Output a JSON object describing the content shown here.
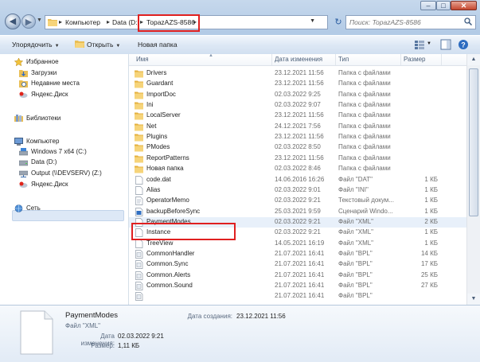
{
  "titlebar": {
    "min": "–",
    "max": "□",
    "close": "✕"
  },
  "address": {
    "crumbs": [
      "Компьютер",
      "Data (D:)",
      "TopazAZS-8586"
    ],
    "search_placeholder": "Поиск: TopazAZS-8586"
  },
  "toolbar": {
    "organize": "Упорядочить",
    "open": "Открыть",
    "new_folder": "Новая папка"
  },
  "nav": {
    "favorites": {
      "label": "Избранное",
      "items": [
        "Загрузки",
        "Недавние места",
        "Яндекс.Диск"
      ]
    },
    "libraries": "Библиотеки",
    "computer": {
      "label": "Компьютер",
      "items": [
        "Windows 7 x64 (C:)",
        "Data (D:)",
        "Output (\\\\DEVSERV) (Z:)",
        "Яндекс.Диск"
      ]
    },
    "network": "Сеть"
  },
  "columns": {
    "name": "Имя",
    "date": "Дата изменения",
    "type": "Тип",
    "size": "Размер"
  },
  "files": [
    {
      "name": "Drivers",
      "date": "23.12.2021 11:56",
      "type": "Папка с файлами",
      "size": "",
      "icon": "folder-icon"
    },
    {
      "name": "Guardant",
      "date": "23.12.2021 11:56",
      "type": "Папка с файлами",
      "size": "",
      "icon": "folder-icon"
    },
    {
      "name": "ImportDoc",
      "date": "02.03.2022 9:25",
      "type": "Папка с файлами",
      "size": "",
      "icon": "folder-icon"
    },
    {
      "name": "Ini",
      "date": "02.03.2022 9:07",
      "type": "Папка с файлами",
      "size": "",
      "icon": "folder-icon"
    },
    {
      "name": "LocalServer",
      "date": "23.12.2021 11:56",
      "type": "Папка с файлами",
      "size": "",
      "icon": "folder-icon"
    },
    {
      "name": "Net",
      "date": "24.12.2021 7:56",
      "type": "Папка с файлами",
      "size": "",
      "icon": "folder-icon"
    },
    {
      "name": "Plugins",
      "date": "23.12.2021 11:56",
      "type": "Папка с файлами",
      "size": "",
      "icon": "folder-icon"
    },
    {
      "name": "PModes",
      "date": "02.03.2022 8:50",
      "type": "Папка с файлами",
      "size": "",
      "icon": "folder-icon"
    },
    {
      "name": "ReportPatterns",
      "date": "23.12.2021 11:56",
      "type": "Папка с файлами",
      "size": "",
      "icon": "folder-icon"
    },
    {
      "name": "Новая папка",
      "date": "02.03.2022 8:46",
      "type": "Папка с файлами",
      "size": "",
      "icon": "folder-icon"
    },
    {
      "name": "code.dat",
      "date": "14.06.2016 16:26",
      "type": "Файл \"DAT\"",
      "size": "1 КБ",
      "icon": "file-icon"
    },
    {
      "name": "Alias",
      "date": "02.03.2022 9:01",
      "type": "Файл \"INI\"",
      "size": "1 КБ",
      "icon": "file-icon"
    },
    {
      "name": "OperatorMemo",
      "date": "02.03.2022 9:21",
      "type": "Текстовый докум...",
      "size": "1 КБ",
      "icon": "text-file-icon"
    },
    {
      "name": "backupBeforeSync",
      "date": "25.03.2021 9:59",
      "type": "Сценарий Windo...",
      "size": "1 КБ",
      "icon": "script-file-icon"
    },
    {
      "name": "PaymentModes",
      "date": "02.03.2022 9:21",
      "type": "Файл \"XML\"",
      "size": "2 КБ",
      "icon": "file-icon"
    },
    {
      "name": "Instance",
      "date": "02.03.2022 9:21",
      "type": "Файл \"XML\"",
      "size": "1 КБ",
      "icon": "file-icon"
    },
    {
      "name": "TreeView",
      "date": "14.05.2021 16:19",
      "type": "Файл \"XML\"",
      "size": "1 КБ",
      "icon": "file-icon"
    },
    {
      "name": "CommonHandler",
      "date": "21.07.2021 16:41",
      "type": "Файл \"BPL\"",
      "size": "14 КБ",
      "icon": "bpl-file-icon"
    },
    {
      "name": "Common.Sync",
      "date": "21.07.2021 16:41",
      "type": "Файл \"BPL\"",
      "size": "17 КБ",
      "icon": "bpl-file-icon"
    },
    {
      "name": "Common.Alerts",
      "date": "21.07.2021 16:41",
      "type": "Файл \"BPL\"",
      "size": "25 КБ",
      "icon": "bpl-file-icon"
    },
    {
      "name": "Common.Sound",
      "date": "21.07.2021 16:41",
      "type": "Файл \"BPL\"",
      "size": "27 КБ",
      "icon": "bpl-file-icon"
    },
    {
      "name": "",
      "date": "21.07.2021 16:41",
      "type": "Файл \"BPL\"",
      "size": "",
      "icon": "bpl-file-icon"
    }
  ],
  "selected_index": 14,
  "details": {
    "name": "PaymentModes",
    "type": "Файл \"XML\"",
    "modified_label": "Дата изменения:",
    "modified_value": "02.03.2022 9:21",
    "size_label": "Размер:",
    "size_value": "1,11 КБ",
    "created_label": "Дата создания:",
    "created_value": "23.12.2021 11:56"
  },
  "colors": {
    "highlight": "#e02020",
    "folder": "#f2c95a",
    "selection": "#e8f0fa"
  }
}
